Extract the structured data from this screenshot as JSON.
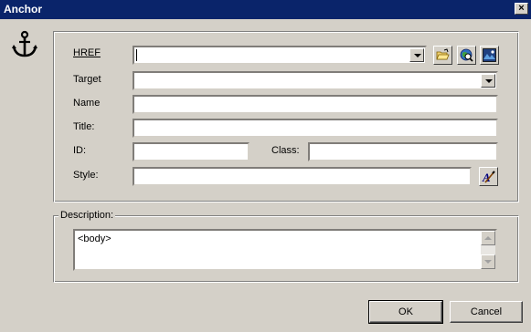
{
  "window": {
    "title": "Anchor",
    "close_label": "×"
  },
  "form": {
    "href": {
      "label": "HREF",
      "value": ""
    },
    "target": {
      "label": "Target",
      "value": ""
    },
    "name": {
      "label": "Name",
      "value": ""
    },
    "title": {
      "label": "Title:",
      "value": ""
    },
    "id": {
      "label": "ID:",
      "value": ""
    },
    "class": {
      "label": "Class:",
      "value": ""
    },
    "style": {
      "label": "Style:",
      "value": ""
    }
  },
  "icons": {
    "anchor": "anchor-icon",
    "browse": "open-folder-icon",
    "find": "find-target-icon",
    "preview": "image-preview-icon",
    "style_editor": "style-editor-icon"
  },
  "description": {
    "label": "Description:",
    "value": "<body>"
  },
  "buttons": {
    "ok": "OK",
    "cancel": "Cancel"
  },
  "colors": {
    "titlebar": "#0a246a",
    "face": "#d4d0c8",
    "field": "#ffffff"
  }
}
